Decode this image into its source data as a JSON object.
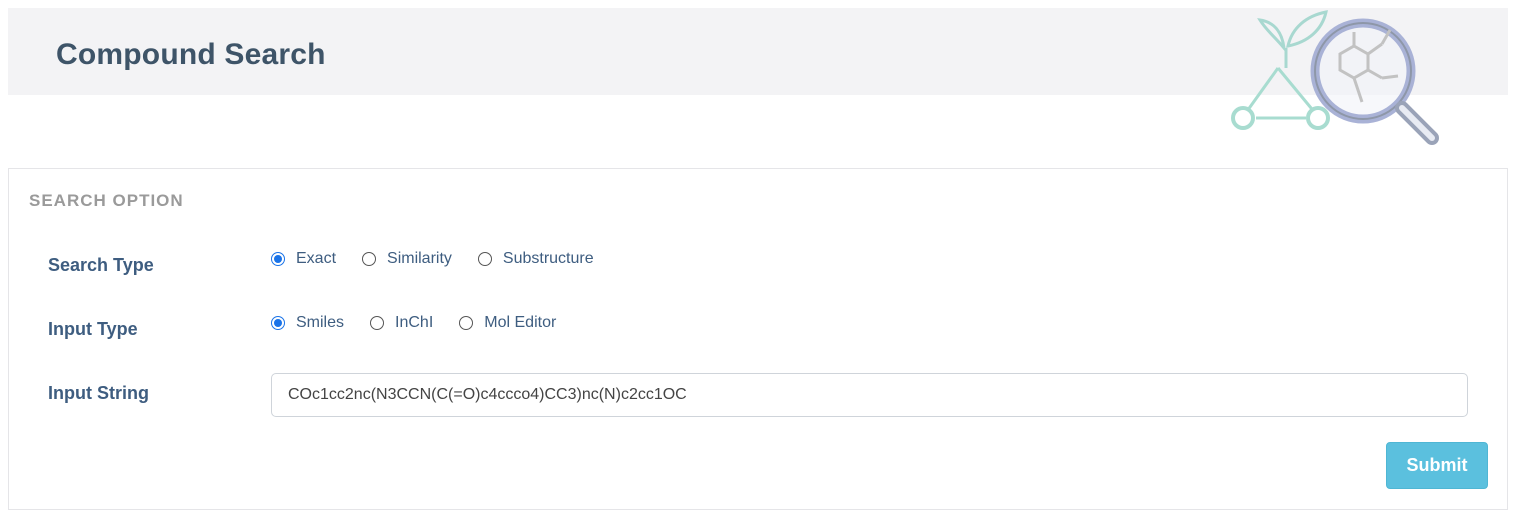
{
  "header": {
    "title": "Compound Search",
    "logo_icon": "magnifier-molecule-leaf-logo"
  },
  "search_option": {
    "title": "SEARCH OPTION",
    "search_type": {
      "label": "Search Type",
      "options": [
        "Exact",
        "Similarity",
        "Substructure"
      ],
      "selected": "Exact"
    },
    "input_type": {
      "label": "Input Type",
      "options": [
        "Smiles",
        "InChI",
        "Mol Editor"
      ],
      "selected": "Smiles"
    },
    "input_string": {
      "label": "Input String",
      "value": "COc1cc2nc(N3CCN(C(=O)c4ccco4)CC3)nc(N)c2cc1OC",
      "placeholder": ""
    },
    "submit_label": "Submit"
  },
  "colors": {
    "title": "#3e5468",
    "label": "#3e5d80",
    "accent": "#1a73e8",
    "submit": "#5bc0de",
    "header_bg": "#f3f3f5"
  }
}
